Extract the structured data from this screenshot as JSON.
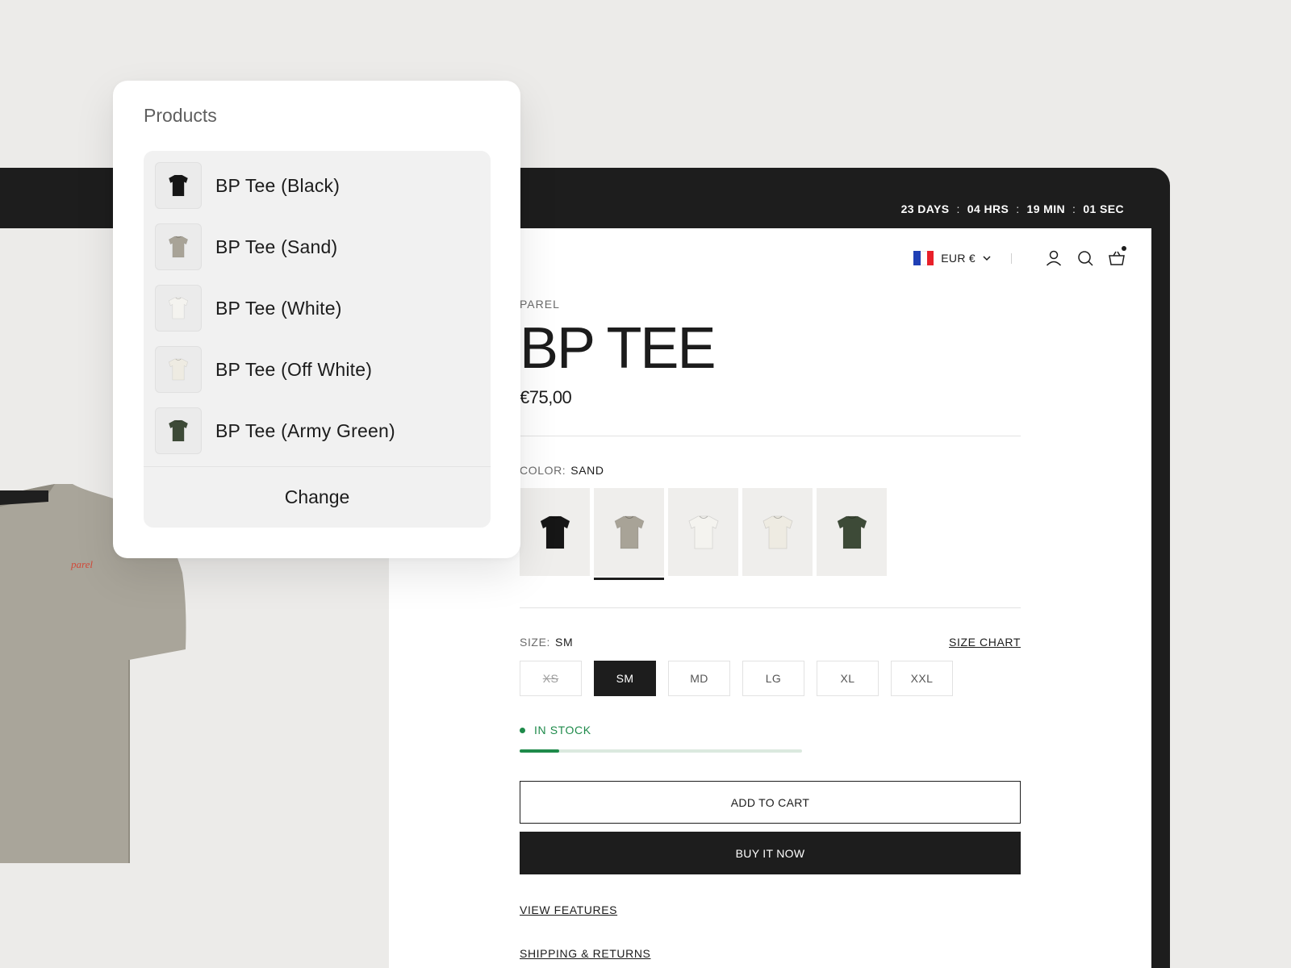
{
  "countdown": {
    "days": "23 DAYS",
    "hrs": "04 HRS",
    "min": "19 MIN",
    "sec": "01 SEC",
    "separator": ":"
  },
  "header": {
    "currency": "EUR €",
    "flag_colors": [
      "#1f3fb5",
      "#ffffff",
      "#e8202a"
    ],
    "icons": [
      "account-icon",
      "search-icon",
      "cart-icon"
    ]
  },
  "product": {
    "vendor": "PAREL",
    "title": "BP TEE",
    "price": "€75,00",
    "shirt_print": "parel"
  },
  "color": {
    "label": "COLOR:",
    "value": "SAND",
    "swatches": [
      {
        "name": "Black",
        "hex": "#161616",
        "selected": false
      },
      {
        "name": "Sand",
        "hex": "#a8a397",
        "selected": true
      },
      {
        "name": "White",
        "hex": "#f4f3ef",
        "selected": false
      },
      {
        "name": "Off White",
        "hex": "#eeebe2",
        "selected": false
      },
      {
        "name": "Army Green",
        "hex": "#3d4a37",
        "selected": false
      }
    ]
  },
  "size": {
    "label": "SIZE:",
    "value": "SM",
    "chart_link": "SIZE CHART",
    "options": [
      {
        "label": "XS",
        "state": "unavailable"
      },
      {
        "label": "SM",
        "state": "selected"
      },
      {
        "label": "MD",
        "state": "available"
      },
      {
        "label": "LG",
        "state": "available"
      },
      {
        "label": "XL",
        "state": "available"
      },
      {
        "label": "XXL",
        "state": "available"
      }
    ]
  },
  "stock": {
    "label": "IN STOCK",
    "level": 0.14,
    "color": "#1e8a4a"
  },
  "actions": {
    "add_to_cart": "ADD TO CART",
    "buy_now": "BUY IT NOW"
  },
  "links": {
    "features": "VIEW FEATURES",
    "shipping": "SHIPPING & RETURNS"
  },
  "popover": {
    "title": "Products",
    "items": [
      {
        "label": "BP Tee (Black)",
        "hex": "#161616"
      },
      {
        "label": "BP Tee (Sand)",
        "hex": "#a8a397"
      },
      {
        "label": "BP Tee (White)",
        "hex": "#f4f3ef"
      },
      {
        "label": "BP Tee (Off White)",
        "hex": "#eeebe2"
      },
      {
        "label": "BP Tee (Army Green)",
        "hex": "#3d4a37"
      }
    ],
    "change_label": "Change"
  }
}
